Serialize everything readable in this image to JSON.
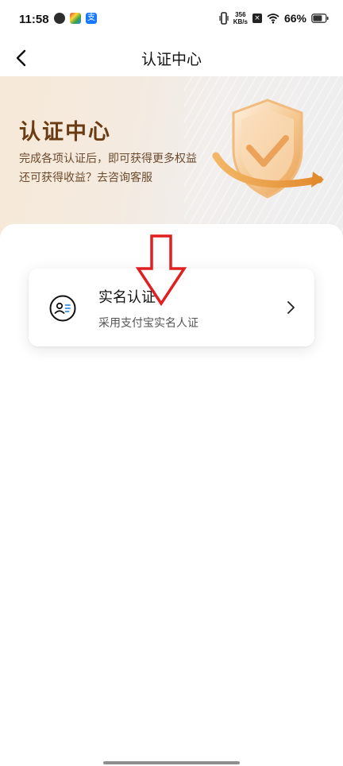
{
  "status_bar": {
    "time": "11:58",
    "net_speed_value": "356",
    "net_speed_unit": "KB/s",
    "battery_percent": "66%",
    "left_icons": [
      "card-icon",
      "browser-icon",
      "colorful-app-icon",
      "alipay-icon"
    ],
    "alipay_glyph": "支"
  },
  "nav": {
    "back_icon": "chevron-left-icon",
    "title": "认证中心"
  },
  "banner": {
    "title": "认证中心",
    "line1": "完成各项认证后，即可获得更多权益",
    "line2": "还可获得收益？去咨询客服",
    "illustration": "shield-check-icon"
  },
  "cards": [
    {
      "icon": "id-card-icon",
      "title": "实名认证",
      "subtitle": "采用支付宝实名人证",
      "chevron": "chevron-right-icon"
    }
  ],
  "colors": {
    "banner_title": "#6b3c13",
    "banner_text": "#6b4a2e",
    "annotation_arrow": "#e02020"
  }
}
